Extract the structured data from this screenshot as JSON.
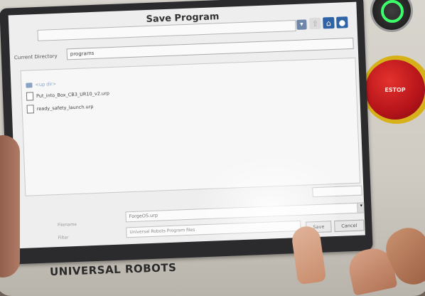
{
  "device": {
    "brand": "UNIVERSAL ROBOTS",
    "estop_label": "ESTOP"
  },
  "dialog": {
    "title": "Save Program",
    "current_directory_label": "Current Directory",
    "current_directory_value": "programs",
    "toolbar": {
      "dropdown_icon": "chevron-down-icon",
      "up_icon": "folder-up-icon",
      "home_icon": "home-icon",
      "new_folder_icon": "new-folder-icon"
    },
    "files": [
      {
        "name": "<up dir>",
        "type": "up"
      },
      {
        "name": "Put_into_Box_CB3_UR10_v2.urp",
        "type": "file"
      },
      {
        "name": "ready_safety_launch.urp",
        "type": "file"
      }
    ],
    "filename_label": "Filename",
    "filename_value": "ForgeOS.urp",
    "filetype_label": "Filter",
    "filetype_value": "Universal Robots Program files",
    "save_label": "Save",
    "cancel_label": "Cancel"
  }
}
